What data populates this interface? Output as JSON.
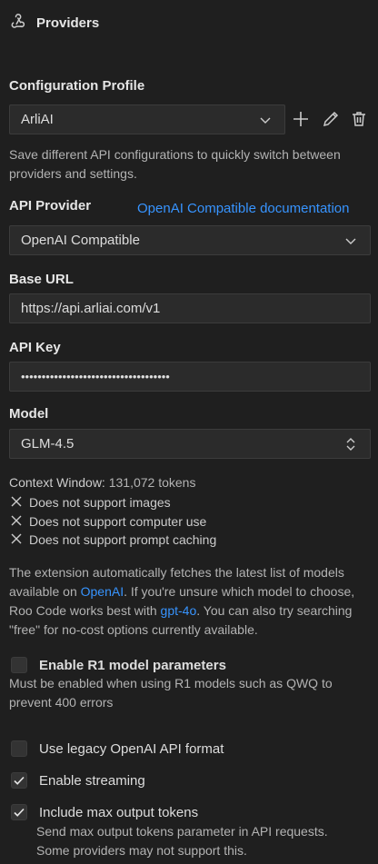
{
  "header": {
    "title": "Providers",
    "icon": "webhook-icon"
  },
  "config_profile": {
    "label": "Configuration Profile",
    "selected": "ArliAI",
    "description": "Save different API configurations to quickly switch between providers and settings."
  },
  "api_provider": {
    "label": "API Provider",
    "doc_link": "OpenAI Compatible documentation",
    "selected": "OpenAI Compatible"
  },
  "base_url": {
    "label": "Base URL",
    "value": "https://api.arliai.com/v1"
  },
  "api_key": {
    "label": "API Key",
    "value": "••••••••••••••••••••••••••••••••••••"
  },
  "model": {
    "label": "Model",
    "selected": "GLM-4.5"
  },
  "context": {
    "label": "Context Window:",
    "value": "131,072 tokens",
    "capabilities": [
      "Does not support images",
      "Does not support computer use",
      "Does not support prompt caching"
    ]
  },
  "info": {
    "line1": "The extension automatically fetches the latest list of models",
    "line2_pre": "available on ",
    "line2_link": "OpenAI",
    "line2_post": ". If you're unsure which model to choose,",
    "line3_pre": "Roo Code works best with ",
    "line3_link": "gpt-4o",
    "line3_post": ". You can also try searching",
    "line4": "\"free\" for no-cost options currently available."
  },
  "r1": {
    "label": "Enable R1 model parameters",
    "checked": false,
    "description_line1": "Must be enabled when using R1 models such as QWQ to",
    "description_line2": "prevent 400 errors"
  },
  "legacy": {
    "label": "Use legacy OpenAI API format",
    "checked": false
  },
  "streaming": {
    "label": "Enable streaming",
    "checked": true
  },
  "max_tokens": {
    "label": "Include max output tokens",
    "checked": true,
    "description_line1": "Send max output tokens parameter in API requests.",
    "description_line2": "Some providers may not support this."
  },
  "colors": {
    "background": "#1f1f1f",
    "field": "#2b2b2b",
    "link": "#3794ff",
    "text": "#cccccc"
  }
}
